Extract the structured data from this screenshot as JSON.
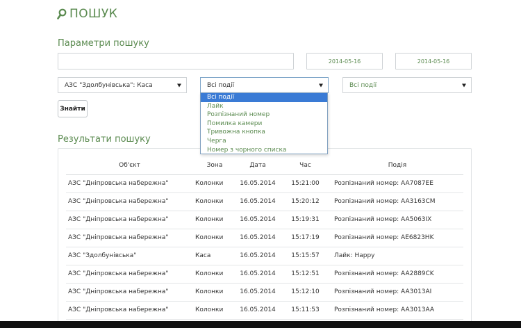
{
  "page": {
    "title": "ПОШУК",
    "params_heading": "Параметри пошуку",
    "results_heading": "Результати пошуку"
  },
  "filters": {
    "query_value": "",
    "date_from": "2014-05-16",
    "date_to": "2014-05-16",
    "object_selected": "АЗС \"Здолбунівська\": Каса",
    "event_selected": "Всі події",
    "zone_selected": "Всі події",
    "search_button": "Знайти"
  },
  "event_options": [
    "Всі події",
    "Лайк",
    "Розпізнаний номер",
    "Помилка камери",
    "Тривожна кнопка",
    "Черга",
    "Номер з чорного списка"
  ],
  "table": {
    "headers": [
      "Об'єкт",
      "Зона",
      "Дата",
      "Час",
      "Подія"
    ],
    "rows": [
      [
        "АЗС \"Дніпровська набережна\"",
        "Колонки",
        "16.05.2014",
        "15:21:00",
        "Розпізнаний номер: AA7087EE"
      ],
      [
        "АЗС \"Дніпровська набережна\"",
        "Колонки",
        "16.05.2014",
        "15:20:12",
        "Розпізнаний номер: AA3163CM"
      ],
      [
        "АЗС \"Дніпровська набережна\"",
        "Колонки",
        "16.05.2014",
        "15:19:31",
        "Розпізнаний номер: AA5063IX"
      ],
      [
        "АЗС \"Дніпровська набережна\"",
        "Колонки",
        "16.05.2014",
        "15:17:19",
        "Розпізнаний номер: AE6823HK"
      ],
      [
        "АЗС \"Здолбунівська\"",
        "Каса",
        "16.05.2014",
        "15:15:57",
        "Лайк: Happy"
      ],
      [
        "АЗС \"Дніпровська набережна\"",
        "Колонки",
        "16.05.2014",
        "15:12:51",
        "Розпізнаний номер: AA2889CK"
      ],
      [
        "АЗС \"Дніпровська набережна\"",
        "Колонки",
        "16.05.2014",
        "15:12:10",
        "Розпізнаний номер: AA3013AI"
      ],
      [
        "АЗС \"Дніпровська набережна\"",
        "Колонки",
        "16.05.2014",
        "15:11:53",
        "Розпізнаний номер: AA3013AA"
      ]
    ]
  },
  "colors": {
    "accent_green": "#5a8a4f",
    "selected_blue": "#3a7bd5"
  }
}
